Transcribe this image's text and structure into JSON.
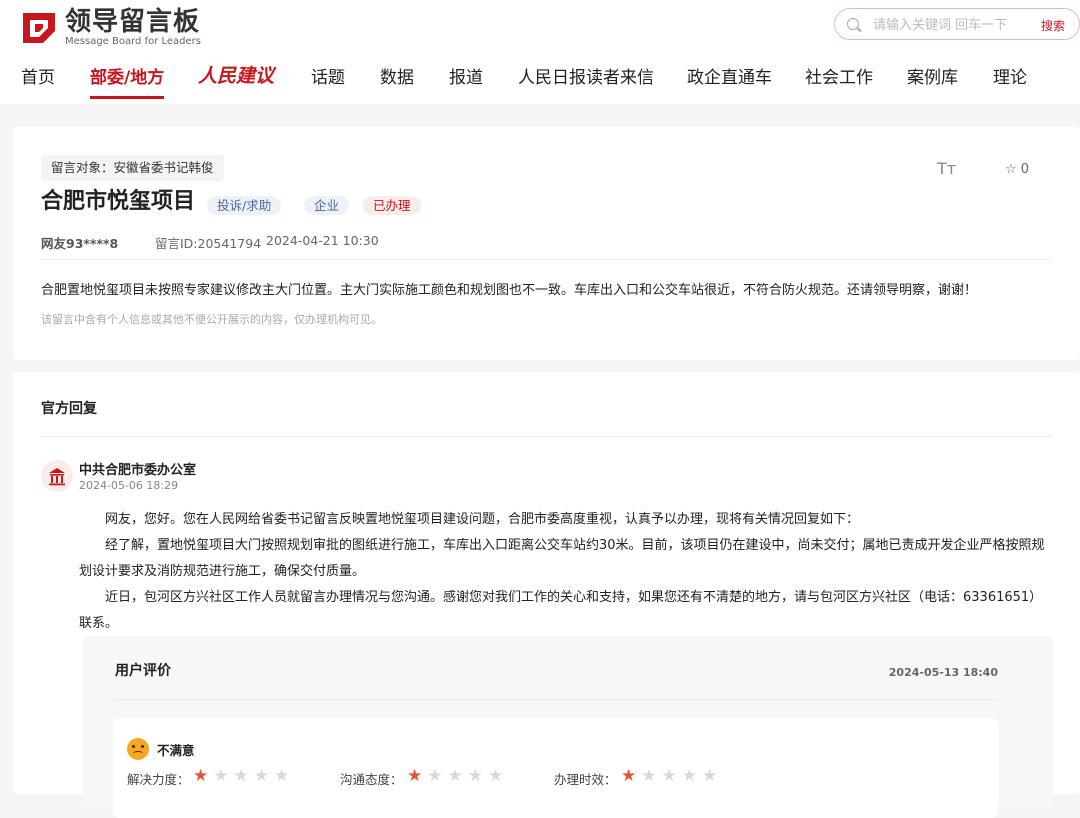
{
  "header": {
    "logo_title": "领导留言板",
    "logo_subtitle": "Message Board for Leaders",
    "search_placeholder": "请输入关键词 回车一下",
    "search_button": "搜索"
  },
  "nav": {
    "items": [
      "首页",
      "部委/地方",
      "人民建议",
      "话题",
      "数据",
      "报道",
      "人民日报读者来信",
      "政企直通车",
      "社会工作",
      "案例库",
      "理论"
    ],
    "active_index": 1
  },
  "message": {
    "target": "留言对象：安徽省委书记韩俊",
    "title": "合肥市悦玺项目",
    "tags": [
      "投诉/求助",
      "企业",
      "已办理"
    ],
    "user": "网友93****8",
    "message_id": "留言ID:20541794",
    "time": "2024-04-21 10:30",
    "font_size_icon": "Tт",
    "favorite_count": "0",
    "content": "合肥置地悦玺项目未按照专家建议修改主大门位置。主大门实际施工颜色和规划图也不一致。车库出入口和公交车站很近，不符合防火规范。还请领导明察，谢谢！",
    "privacy_note": "该留言中含有个人信息或其他不便公开展示的内容，仅办理机构可见。"
  },
  "reply": {
    "section_title": "官方回复",
    "department": "中共合肥市委办公室",
    "time": "2024-05-06 18:29",
    "paragraphs": [
      "网友，您好。您在人民网给省委书记留言反映置地悦玺项目建设问题，合肥市委高度重视，认真予以办理，现将有关情况回复如下：",
      "经了解，置地悦玺项目大门按照规划审批的图纸进行施工，车库出入口距离公交车站约30米。目前，该项目仍在建设中，尚未交付；属地已责成开发企业严格按照规划设计要求及消防规范进行施工，确保交付质量。",
      "近日，包河区方兴社区工作人员就留言办理情况与您沟通。感谢您对我们工作的关心和支持，如果您还有不清楚的地方，请与包河区方兴社区（电话：63361651）联系。"
    ]
  },
  "evaluation": {
    "title": "用户评价",
    "time": "2024-05-13 18:40",
    "verdict": "不满意",
    "ratings": [
      {
        "label": "解决力度：",
        "stars": 1,
        "max": 5
      },
      {
        "label": "沟通态度：",
        "stars": 1,
        "max": 5
      },
      {
        "label": "办理时效：",
        "stars": 1,
        "max": 5
      }
    ]
  },
  "colors": {
    "brand": "#c8161d",
    "star_on": "#e8543a",
    "star_off": "#d9d9d9"
  }
}
